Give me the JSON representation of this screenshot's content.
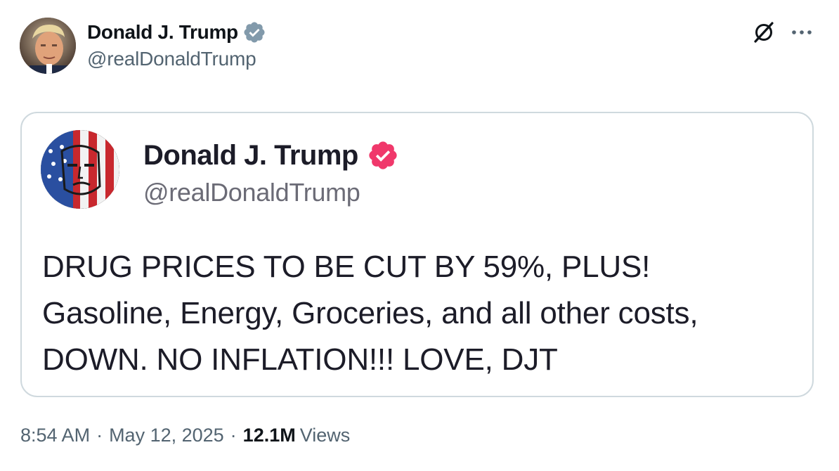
{
  "tweet": {
    "author": {
      "name": "Donald J. Trump",
      "handle": "@realDonaldTrump",
      "verified_badge": "gray-verified-icon",
      "badge_color": "#829aab"
    },
    "actions": {
      "grok_icon": "grok-icon",
      "more_icon": "more-icon"
    },
    "quoted_post": {
      "author": {
        "name": "Donald J. Trump",
        "handle": "@realDonaldTrump",
        "verified_badge": "pink-verified-icon",
        "badge_color": "#f0386b"
      },
      "text_lines": [
        "DRUG PRICES TO BE CUT BY 59%, PLUS!",
        "Gasoline, Energy, Groceries, and all other costs,",
        "DOWN. NO INFLATION!!! LOVE, DJT"
      ]
    },
    "meta": {
      "time": "8:54 AM",
      "separator": "·",
      "date": "May 12, 2025",
      "views_count": "12.1M",
      "views_label": "Views"
    }
  },
  "colors": {
    "text_primary": "#0f1419",
    "text_secondary": "#536471",
    "card_border": "#cfd9de"
  }
}
